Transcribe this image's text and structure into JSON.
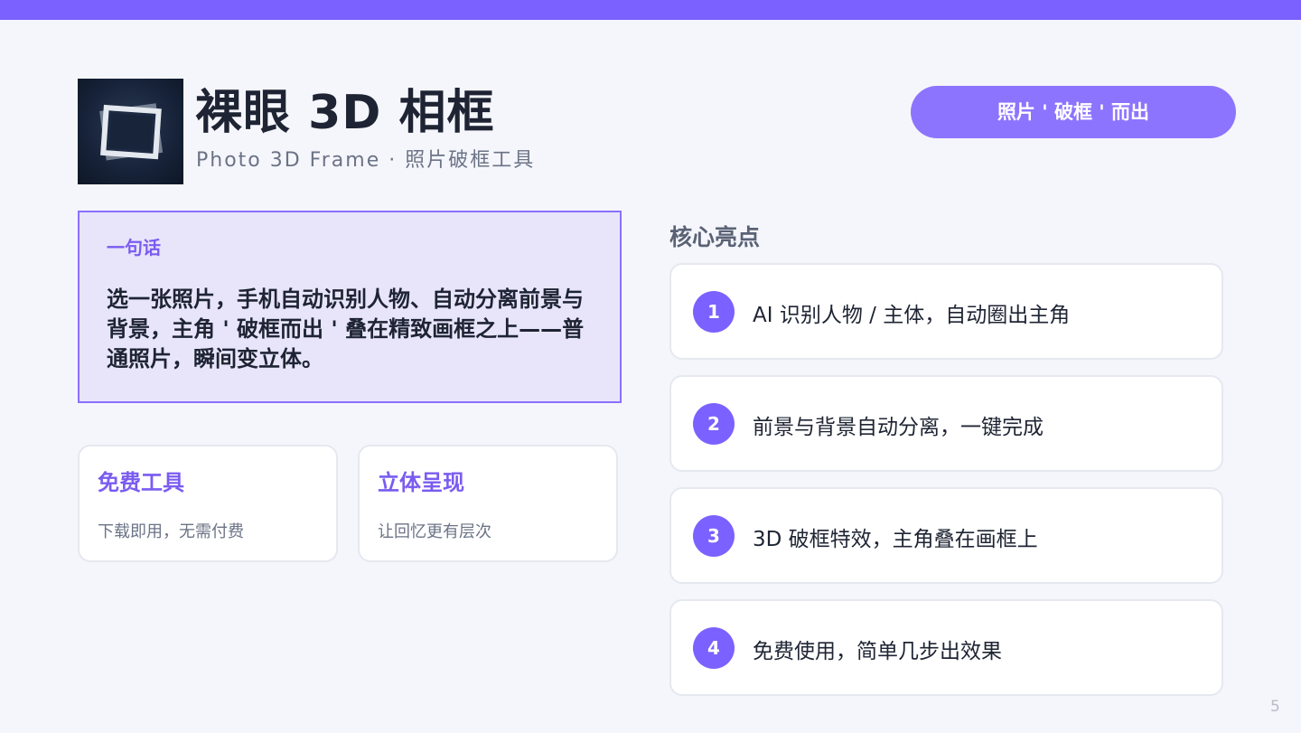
{
  "header": {
    "title": "裸眼 3D 相框",
    "subtitle": "Photo 3D Frame · 照片破框工具",
    "tag": "照片 ' 破框 ' 而出"
  },
  "summary": {
    "label": "一句话",
    "text": "选一张照片，手机自动识别人物、自动分离前景与背景，主角 ' 破框而出 ' 叠在精致画框之上——普通照片，瞬间变立体。"
  },
  "features": [
    {
      "title": "免费工具",
      "desc": "下载即用，无需付费"
    },
    {
      "title": "立体呈现",
      "desc": "让回忆更有层次"
    }
  ],
  "highlights": {
    "title": "核心亮点",
    "items": [
      {
        "num": "1",
        "text": "AI  识别人物  /  主体，自动圈出主角"
      },
      {
        "num": "2",
        "text": "前景与背景自动分离，一键完成"
      },
      {
        "num": "3",
        "text": "3D  破框特效，主角叠在画框上"
      },
      {
        "num": "4",
        "text": "免费使用，简单几步出效果"
      }
    ]
  },
  "page_number": "5",
  "colors": {
    "accent": "#7b61ff",
    "pill": "#8d74ff",
    "summary_bg": "#e8e5fb",
    "text": "#1e2433"
  },
  "icons": {
    "logo": "photo-frame-icon"
  }
}
